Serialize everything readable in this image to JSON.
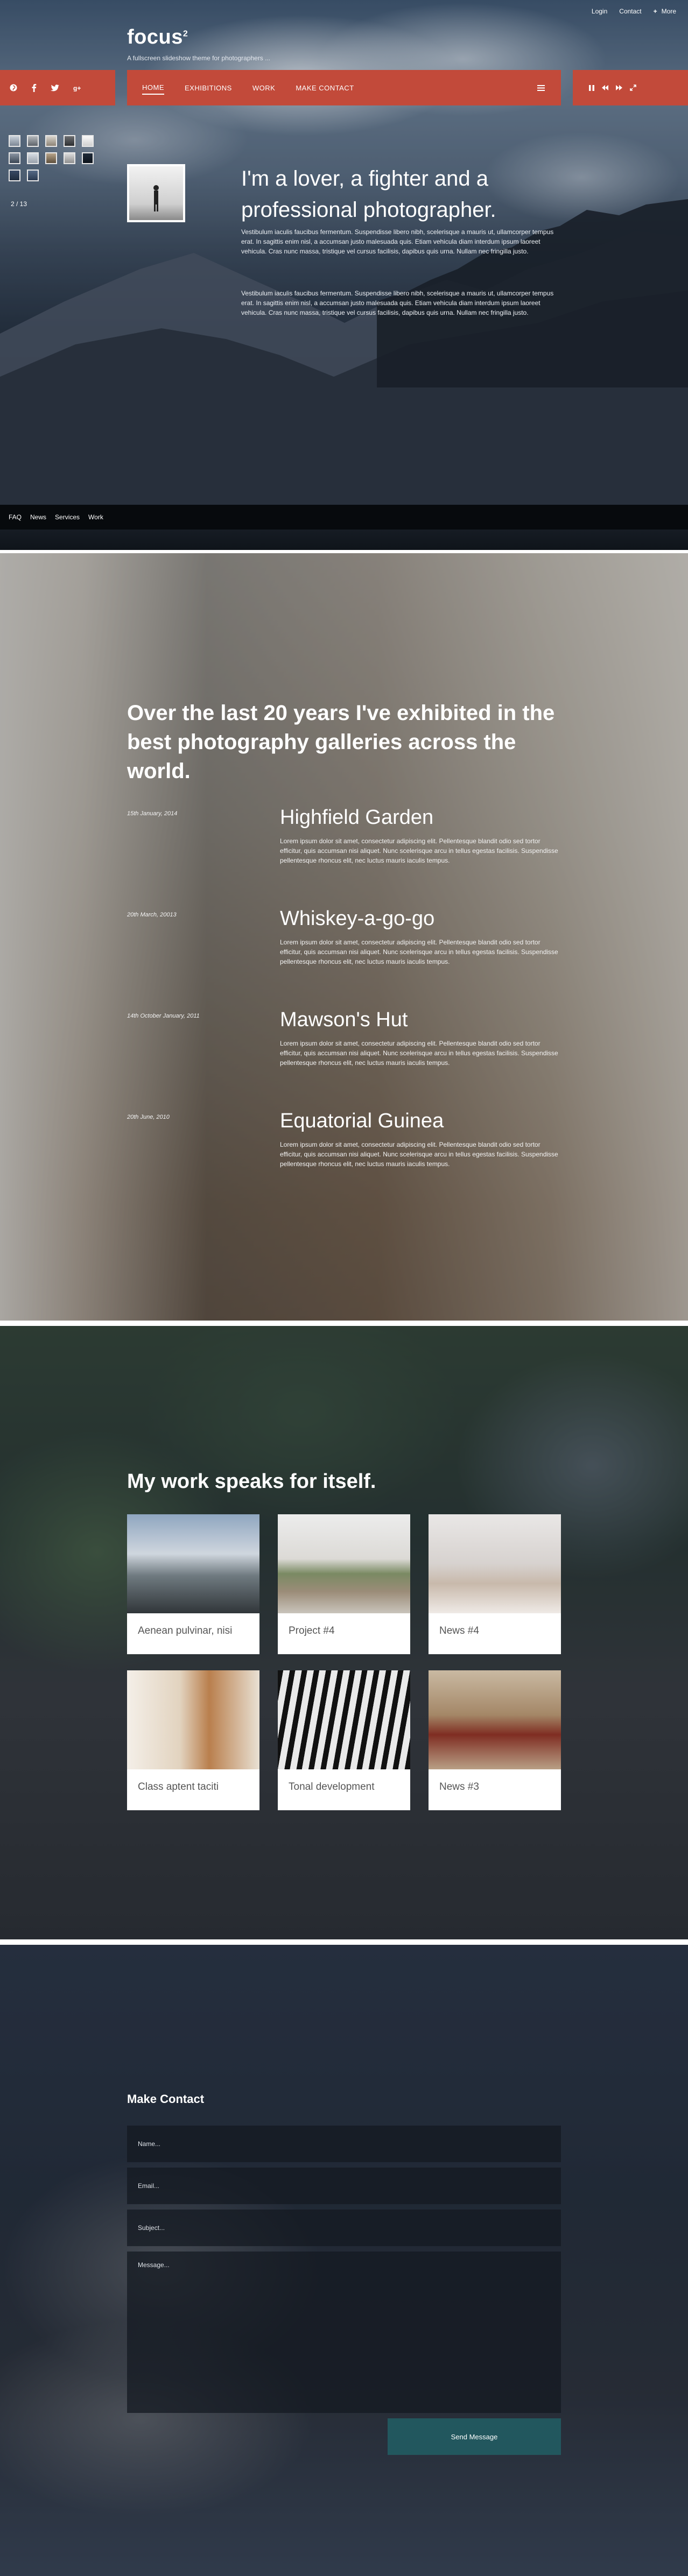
{
  "top_links": {
    "login": "Login",
    "contact": "Contact",
    "more": "More"
  },
  "brand": {
    "title": "focus",
    "superscript": "2",
    "tagline": "A fullscreen slideshow theme for photographers ..."
  },
  "nav": {
    "items": [
      "HOME",
      "EXHIBITIONS",
      "WORK",
      "MAKE CONTACT"
    ]
  },
  "slideshow": {
    "counter": "2 / 13"
  },
  "intro": {
    "title": "I'm a lover, a fighter and a professional photographer.",
    "p1": "Vestibulum iaculis faucibus fermentum. Suspendisse libero nibh, scelerisque a mauris ut, ullamcorper tempus erat. In sagittis enim nisl, a accumsan justo malesuada quis. Etiam vehicula diam interdum ipsum laoreet vehicula. Cras nunc massa, tristique vel cursus facilisis, dapibus quis urna. Nullam nec fringilla justo.",
    "p2": "Vestibulum iaculis faucibus fermentum. Suspendisse libero nibh, scelerisque a mauris ut, ullamcorper tempus erat. In sagittis enim nisl, a accumsan justo malesuada quis. Etiam vehicula diam interdum ipsum laoreet vehicula. Cras nunc massa, tristique vel cursus facilisis, dapibus quis urna. Nullam nec fringilla justo."
  },
  "footer_links": [
    "FAQ",
    "News",
    "Services",
    "Work"
  ],
  "exhibitions": {
    "title": "Over the last 20 years I've exhibited in the best photography galleries across the world.",
    "items": [
      {
        "date": "15th January, 2014",
        "name": "Highfield Garden",
        "desc": "Lorem ipsum dolor sit amet, consectetur adipiscing elit. Pellentesque blandit odio sed tortor efficitur, quis accumsan nisi aliquet. Nunc scelerisque arcu in tellus egestas facilisis. Suspendisse pellentesque rhoncus elit, nec luctus mauris iaculis tempus."
      },
      {
        "date": "20th March, 20013",
        "name": "Whiskey-a-go-go",
        "desc": "Lorem ipsum dolor sit amet, consectetur adipiscing elit. Pellentesque blandit odio sed tortor efficitur, quis accumsan nisi aliquet. Nunc scelerisque arcu in tellus egestas facilisis. Suspendisse pellentesque rhoncus elit, nec luctus mauris iaculis tempus."
      },
      {
        "date": "14th October January, 2011",
        "name": "Mawson's Hut",
        "desc": "Lorem ipsum dolor sit amet, consectetur adipiscing elit. Pellentesque blandit odio sed tortor efficitur, quis accumsan nisi aliquet. Nunc scelerisque arcu in tellus egestas facilisis. Suspendisse pellentesque rhoncus elit, nec luctus mauris iaculis tempus."
      },
      {
        "date": "20th June, 2010",
        "name": "Equatorial Guinea",
        "desc": "Lorem ipsum dolor sit amet, consectetur adipiscing elit. Pellentesque blandit odio sed tortor efficitur, quis accumsan nisi aliquet. Nunc scelerisque arcu in tellus egestas facilisis. Suspendisse pellentesque rhoncus elit, nec luctus mauris iaculis tempus."
      }
    ]
  },
  "work": {
    "title": "My work speaks for itself.",
    "cards": [
      {
        "label": "Aenean pulvinar, nisi"
      },
      {
        "label": "Project #4"
      },
      {
        "label": "News #4"
      },
      {
        "label": "Class aptent taciti"
      },
      {
        "label": "Tonal development"
      },
      {
        "label": "News #3"
      }
    ]
  },
  "contact": {
    "title": "Make Contact",
    "name_placeholder": "Name...",
    "email_placeholder": "Email...",
    "subject_placeholder": "Subject...",
    "message_placeholder": "Message...",
    "send_label": "Send Message"
  },
  "colors": {
    "accent": "#c24a3a",
    "button": "#22575e"
  }
}
